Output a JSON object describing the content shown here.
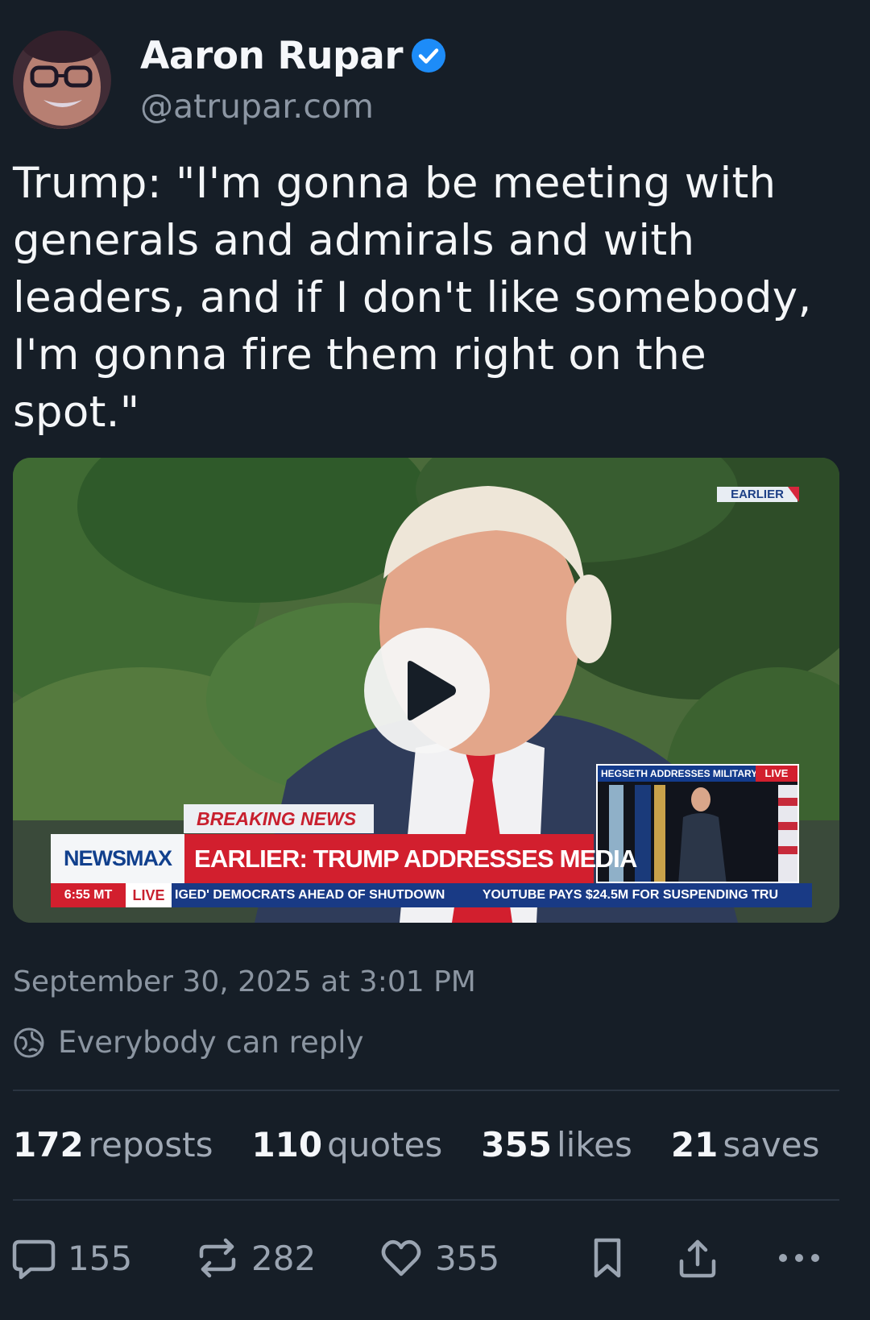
{
  "author": {
    "display_name": "Aaron Rupar",
    "handle": "@atrupar.com",
    "verified": true,
    "verified_color": "#1d8cf8"
  },
  "post": {
    "text": "Trump: \"I'm gonna be meeting with generals and admirals and with leaders, and if I don't like somebody, I'm gonna fire them right on the spot.\"",
    "timestamp": "September 30, 2025 at 3:01 PM",
    "reply_setting": "Everybody can reply"
  },
  "video": {
    "corner_tag": "EARLIER",
    "breaking_label": "BREAKING NEWS",
    "network": "NEWSMAX",
    "headline": "EARLIER: TRUMP ADDRESSES MEDIA",
    "local_time": "6:55 MT",
    "live_label": "LIVE",
    "ticker_items": [
      "IGED' DEMOCRATS AHEAD OF SHUTDOWN",
      "YOUTUBE PAYS $24.5M FOR SUSPENDING TRU"
    ],
    "inset_title": "HEGSETH ADDRESSES MILITARY",
    "inset_live": "LIVE"
  },
  "stats": {
    "reposts": {
      "count": "172",
      "label": "reposts"
    },
    "quotes": {
      "count": "110",
      "label": "quotes"
    },
    "likes": {
      "count": "355",
      "label": "likes"
    },
    "saves": {
      "count": "21",
      "label": "saves"
    }
  },
  "actions": {
    "reply_count": "155",
    "repost_count": "282",
    "like_count": "355",
    "icons": [
      "reply-icon",
      "repost-icon",
      "like-icon",
      "bookmark-icon",
      "share-icon",
      "more-icon"
    ]
  },
  "colors": {
    "background": "#161e27",
    "text_primary": "#f1f3f5",
    "text_secondary": "#8b95a1",
    "divider": "#2a3441"
  }
}
